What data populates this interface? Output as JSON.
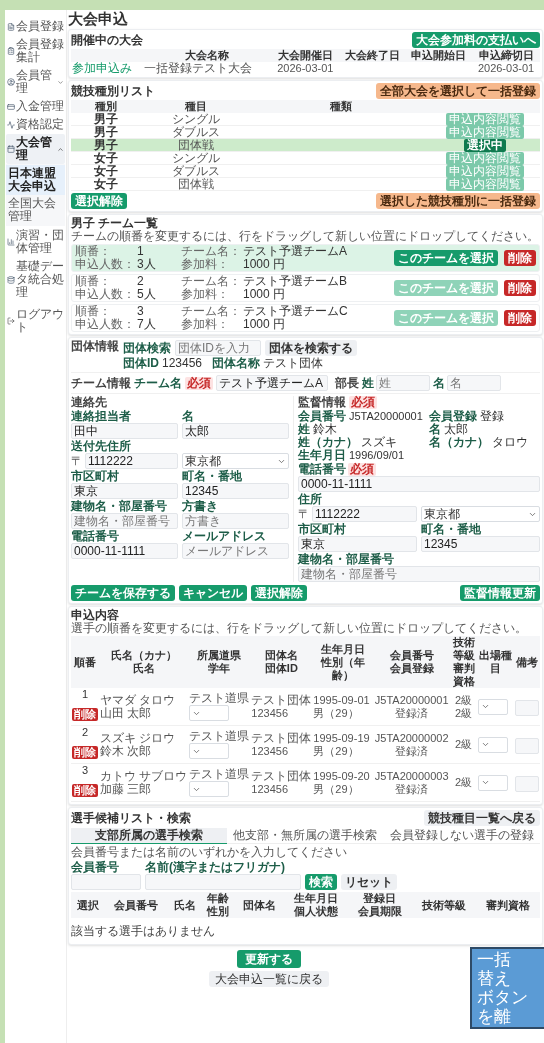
{
  "sidebar": {
    "items": [
      {
        "label": "会員登録",
        "selected": false
      },
      {
        "label": "会員登録集計",
        "selected": false
      },
      {
        "label": "会員管理",
        "selected": false,
        "expanded": false
      },
      {
        "label": "入金管理",
        "selected": false
      },
      {
        "label": "資格認定",
        "selected": false
      },
      {
        "label": "大会管理",
        "selected": true,
        "expanded": true,
        "children": [
          {
            "label": "日本連盟大会申込",
            "selected": true
          },
          {
            "label": "全国大会管理",
            "selected": false
          }
        ]
      },
      {
        "label": "演習・団体管理",
        "selected": false
      },
      {
        "label": "基礎データ統合処理",
        "selected": false
      }
    ],
    "logout": "ログアウト"
  },
  "page_title": "大会申込",
  "open_tournaments": {
    "title": "開催中の大会",
    "columns": [
      "大会名称",
      "大会開催日",
      "大会終了日",
      "申込開始日",
      "申込締切日"
    ],
    "rows": [
      {
        "link": "参加申込み",
        "name": "一括登録テスト大会",
        "start_date": "2026-03-01",
        "deadline": "2026-03-01"
      }
    ],
    "pay_button": "大会参加料の支払いへ"
  },
  "event_types": {
    "title": "競技種別リスト",
    "bulk_button": "全部大会を選択して一括登録",
    "columns": [
      "種別",
      "種目",
      "種類"
    ],
    "rows": [
      {
        "category": "男子",
        "event": "シングル",
        "badge": "申込内容閲覧",
        "selected": false
      },
      {
        "category": "男子",
        "event": "ダブルス",
        "badge": "申込内容閲覧",
        "selected": false
      },
      {
        "category": "男子",
        "event": "団体戦",
        "badge": "選択中",
        "selected": true
      },
      {
        "category": "女子",
        "event": "シングル",
        "badge": "申込内容閲覧",
        "selected": false
      },
      {
        "category": "女子",
        "event": "ダブルス",
        "badge": "申込内容閲覧",
        "selected": false
      },
      {
        "category": "女子",
        "event": "団体戦",
        "badge": "申込内容閲覧",
        "selected": false
      }
    ],
    "clear_button": "選択解除"
  },
  "register_selected_button": "選択した競技種別に一括登録",
  "team_list": {
    "title": "男子 チーム一覧",
    "description": "チームの順番を変更するには、行をドラッグして新しい位置にドロップしてください。",
    "teams": [
      {
        "selected": true,
        "fields": [
          {
            "label": "順番：",
            "value": "1"
          },
          {
            "label": "チーム名：",
            "value": "テスト予選チームA"
          },
          {
            "label": "申込人数：",
            "value": "3人"
          },
          {
            "label": "参加料：",
            "value": "1000 円"
          }
        ],
        "select_button": "このチームを選択",
        "delete_button": "削除"
      },
      {
        "selected": false,
        "fields": [
          {
            "label": "順番：",
            "value": "2"
          },
          {
            "label": "チーム名：",
            "value": "テスト予選チームB"
          },
          {
            "label": "申込人数：",
            "value": "5人"
          },
          {
            "label": "参加料：",
            "value": "1000 円"
          }
        ],
        "select_button": "このチームを選択",
        "delete_button": "削除"
      },
      {
        "selected": false,
        "fields": [
          {
            "label": "順番：",
            "value": "3"
          },
          {
            "label": "チーム名：",
            "value": "テスト予選チームC"
          },
          {
            "label": "申込人数：",
            "value": "7人"
          },
          {
            "label": "参加料：",
            "value": "1000 円"
          }
        ],
        "select_button": "このチームを選択",
        "delete_button": "削除"
      }
    ]
  },
  "organization": {
    "label": "団体情報",
    "search_label": "団体検索",
    "search_placeholder": "団体IDを入力",
    "search_button": "団体を検索する",
    "details": [
      {
        "label": "団体ID",
        "value": "123456"
      },
      {
        "label": "団体名称",
        "value": "テスト団体"
      }
    ]
  },
  "team_info": {
    "label": "チーム情報",
    "field_label": "チーム名",
    "required": "必須",
    "value": "テスト予選チームA"
  },
  "manager": {
    "label": "部長",
    "fields": [
      {
        "label": "姓",
        "placeholder": "姓"
      },
      {
        "label": "名",
        "placeholder": "名"
      }
    ]
  },
  "contact": {
    "label": "連絡先",
    "rows": [
      [
        {
          "kind": "input",
          "label": "連絡担当者",
          "value": "田中"
        },
        {
          "kind": "input",
          "label": "名",
          "value": "太郎"
        }
      ],
      [
        {
          "kind": "postal",
          "label": "送付先住所",
          "mark": "〒",
          "value": "1112222"
        },
        {
          "kind": "select",
          "value": "東京都"
        }
      ],
      [
        {
          "kind": "input",
          "label": "市区町村",
          "value": "東京"
        },
        {
          "kind": "input",
          "label": "町名・番地",
          "value": "12345"
        }
      ],
      [
        {
          "kind": "input",
          "label": "建物名・部屋番号",
          "placeholder": "建物名・部屋番号"
        },
        {
          "kind": "input",
          "label": "方書き",
          "placeholder": "方書き"
        }
      ],
      [
        {
          "kind": "input",
          "label": "電話番号",
          "value": "0000-11-1111"
        },
        {
          "kind": "input",
          "label": "メールアドレス",
          "placeholder": "メールアドレス"
        }
      ]
    ]
  },
  "coach": {
    "label": "監督情報",
    "required": "必須",
    "details": [
      {
        "label": "会員番号",
        "value": "J5TA20000001"
      },
      {
        "label": "会員登録",
        "value": "登録"
      },
      {
        "label": "姓",
        "value": "鈴木"
      },
      {
        "label": "名",
        "value": "太郎"
      },
      {
        "label": "姓（カナ）",
        "value": "スズキ"
      },
      {
        "label": "名（カナ）",
        "value": "タロウ"
      },
      {
        "label": "生年月日",
        "value": "1996/09/01"
      }
    ],
    "rows": [
      [
        {
          "kind": "input",
          "label": "電話番号",
          "required": "必須",
          "value": "0000-11-1111"
        }
      ],
      [
        {
          "kind": "postal",
          "label": "住所",
          "mark": "〒",
          "value": "1112222"
        },
        {
          "kind": "select",
          "value": "東京都"
        }
      ],
      [
        {
          "kind": "input",
          "label": "市区町村",
          "value": "東京"
        },
        {
          "kind": "input",
          "label": "町名・番地",
          "value": "12345"
        }
      ],
      [
        {
          "kind": "input",
          "label": "建物名・部屋番号",
          "placeholder": "建物名・部屋番号"
        }
      ]
    ]
  },
  "form_buttons": {
    "save": "チームを保存する",
    "cancel": "キャンセル",
    "update_coach": "監督情報更新",
    "clear": "選択解除"
  },
  "entries": {
    "title": "申込内容",
    "description": "選手の順番を変更するには、行をドラッグして新しい位置にドロップしてください。",
    "columns": [
      [
        "順番"
      ],
      [
        "氏名（カナ）",
        "氏名"
      ],
      [
        "所属道県",
        "学年"
      ],
      [
        "団体名",
        "団体ID"
      ],
      [
        "生年月日",
        "性別（年齢）"
      ],
      [
        "会員番号",
        "会員登録"
      ],
      [
        "技術等級",
        "審判資格"
      ],
      [
        "出場種目"
      ],
      [
        "備考"
      ]
    ],
    "rows": [
      {
        "order": "1",
        "delete": "削除",
        "kana": "ヤマダ タロウ",
        "name": "山田 太郎",
        "prefecture": "テスト道県",
        "org": "テスト団体",
        "org_id": "123456",
        "birth": "1995-09-01",
        "sex_age": "男（29）",
        "member_no": "J5TA20000001",
        "status": "登録済",
        "grades": [
          "2級",
          "2級"
        ]
      },
      {
        "order": "2",
        "delete": "削除",
        "kana": "スズキ ジロウ",
        "name": "鈴木 次郎",
        "prefecture": "テスト道県",
        "org": "テスト団体",
        "org_id": "123456",
        "birth": "1995-09-19",
        "sex_age": "男（29）",
        "member_no": "J5TA20000002",
        "status": "登録済",
        "grades": [
          "2級"
        ]
      },
      {
        "order": "3",
        "delete": "削除",
        "kana": "カトウ サブロウ",
        "name": "加藤 三郎",
        "prefecture": "テスト道県",
        "org": "テスト団体",
        "org_id": "123456",
        "birth": "1995-09-20",
        "sex_age": "男（29）",
        "member_no": "J5TA20000003",
        "status": "登録済",
        "grades": [
          "2級"
        ]
      }
    ]
  },
  "candidates": {
    "title": "選手候補リスト・検索",
    "back_button": "競技種目一覧へ戻る",
    "tabs": [
      {
        "label": "支部所属の選手検索",
        "selected": true
      },
      {
        "label": "他支部・無所属の選手検索",
        "selected": false
      },
      {
        "label": "会員登録しない選手の登録",
        "selected": false
      }
    ],
    "hint": "会員番号または名前のいずれかを入力してください",
    "fields": [
      {
        "label": "会員番号"
      },
      {
        "label": "名前(漢字またはフリガナ)"
      }
    ],
    "search_button": "検索",
    "reset_button": "リセット",
    "columns": [
      [
        "選択"
      ],
      [
        "会員番号"
      ],
      [
        "氏名"
      ],
      [
        "年齢",
        "性別"
      ],
      [
        "団体名"
      ],
      [
        "生年月日",
        "個人状態"
      ],
      [
        "登録日",
        "会員期限"
      ],
      [
        "技術等級"
      ],
      [
        "審判資格"
      ]
    ],
    "empty": "該当する選手はありません"
  },
  "footer": {
    "submit": "更新する",
    "back": "大会申込一覧に戻る"
  },
  "callout": {
    "lines": [
      "一括",
      "替え",
      "ボタン",
      "を離"
    ]
  }
}
